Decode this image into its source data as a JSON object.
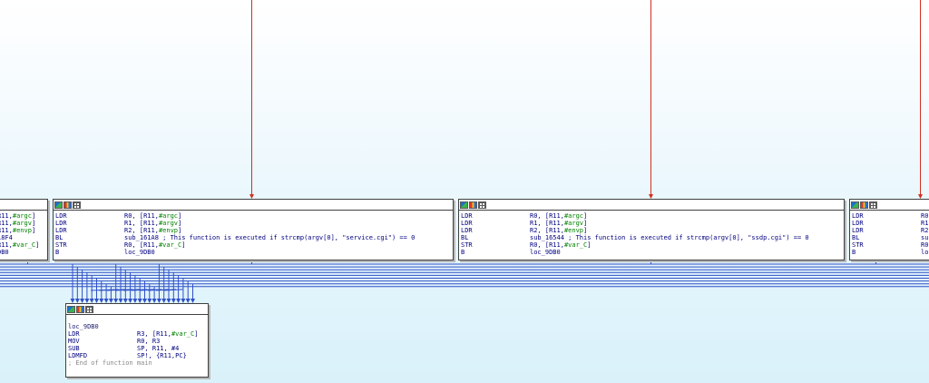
{
  "window": {
    "background": "#e6f6fc",
    "edge_color_taken": "#d03020",
    "edge_color_branch": "#3050c8"
  },
  "node_header_icons": [
    "graph-icon",
    "color-icon",
    "grid-icon"
  ],
  "nodes": {
    "left_partial": {
      "lines": [
        {
          "op_pre": "R11,",
          "var": "#argc",
          "op_post": "]"
        },
        {
          "op_pre": "R11,",
          "var": "#argv",
          "op_post": "]"
        },
        {
          "op_pre": "R11,",
          "var": "#envp",
          "op_post": "]"
        },
        {
          "op_pre": "18F4",
          "var": "",
          "op_post": ""
        },
        {
          "op_pre": "R11,",
          "var": "#var_C",
          "op_post": "]"
        },
        {
          "op_pre": "DB0",
          "var": "",
          "op_post": ""
        }
      ]
    },
    "service_block": {
      "lines": [
        {
          "mnemonic": "LDR",
          "op_pre": "R0, [R11,",
          "var": "#argc",
          "op_post": "]"
        },
        {
          "mnemonic": "LDR",
          "op_pre": "R1, [R11,",
          "var": "#argv",
          "op_post": "]"
        },
        {
          "mnemonic": "LDR",
          "op_pre": "R2, [R11,",
          "var": "#envp",
          "op_post": "]"
        },
        {
          "mnemonic": "BL",
          "op_pre": "sub_161A8 ; This function is executed if strcmp(argv[0], \"service.cgi\") == 0",
          "var": "",
          "op_post": ""
        },
        {
          "mnemonic": "STR",
          "op_pre": "R0, [R11,",
          "var": "#var_C",
          "op_post": "]"
        },
        {
          "mnemonic": "B",
          "op_pre": "loc_9DB0",
          "var": "",
          "op_post": ""
        }
      ]
    },
    "ssdp_block": {
      "lines": [
        {
          "mnemonic": "LDR",
          "op_pre": "R0, [R11,",
          "var": "#argc",
          "op_post": "]"
        },
        {
          "mnemonic": "LDR",
          "op_pre": "R1, [R11,",
          "var": "#argv",
          "op_post": "]"
        },
        {
          "mnemonic": "LDR",
          "op_pre": "R2, [R11,",
          "var": "#envp",
          "op_post": "]"
        },
        {
          "mnemonic": "BL",
          "op_pre": "sub_16544 ; This function is executed if strcmp(argv[0], \"ssdp.cgi\") == 0",
          "var": "",
          "op_post": ""
        },
        {
          "mnemonic": "STR",
          "op_pre": "R0, [R11,",
          "var": "#var_C",
          "op_post": "]"
        },
        {
          "mnemonic": "B",
          "op_pre": "loc_9DB0",
          "var": "",
          "op_post": ""
        }
      ]
    },
    "right_partial": {
      "lines": [
        {
          "mnemonic": "LDR",
          "op_pre": "R0"
        },
        {
          "mnemonic": "LDR",
          "op_pre": "R1"
        },
        {
          "mnemonic": "LDR",
          "op_pre": "R2"
        },
        {
          "mnemonic": "BL",
          "op_pre": "su"
        },
        {
          "mnemonic": "STR",
          "op_pre": "R0"
        },
        {
          "mnemonic": "B",
          "op_pre": "lo"
        }
      ]
    },
    "exit_block": {
      "label": "loc_9DB0",
      "lines": [
        {
          "mnemonic": "LDR",
          "op_pre": "R3, [R11,",
          "var": "#var_C",
          "op_post": "]"
        },
        {
          "mnemonic": "MOV",
          "op_pre": "R0, R3",
          "var": "",
          "op_post": ""
        },
        {
          "mnemonic": "SUB",
          "op_pre": "SP, R11, #4",
          "var": "",
          "op_post": ""
        },
        {
          "mnemonic": "LDMFD",
          "op_pre": "SP!, {R11,PC}",
          "var": "",
          "op_post": ""
        }
      ],
      "comment": "; End of function main"
    }
  }
}
